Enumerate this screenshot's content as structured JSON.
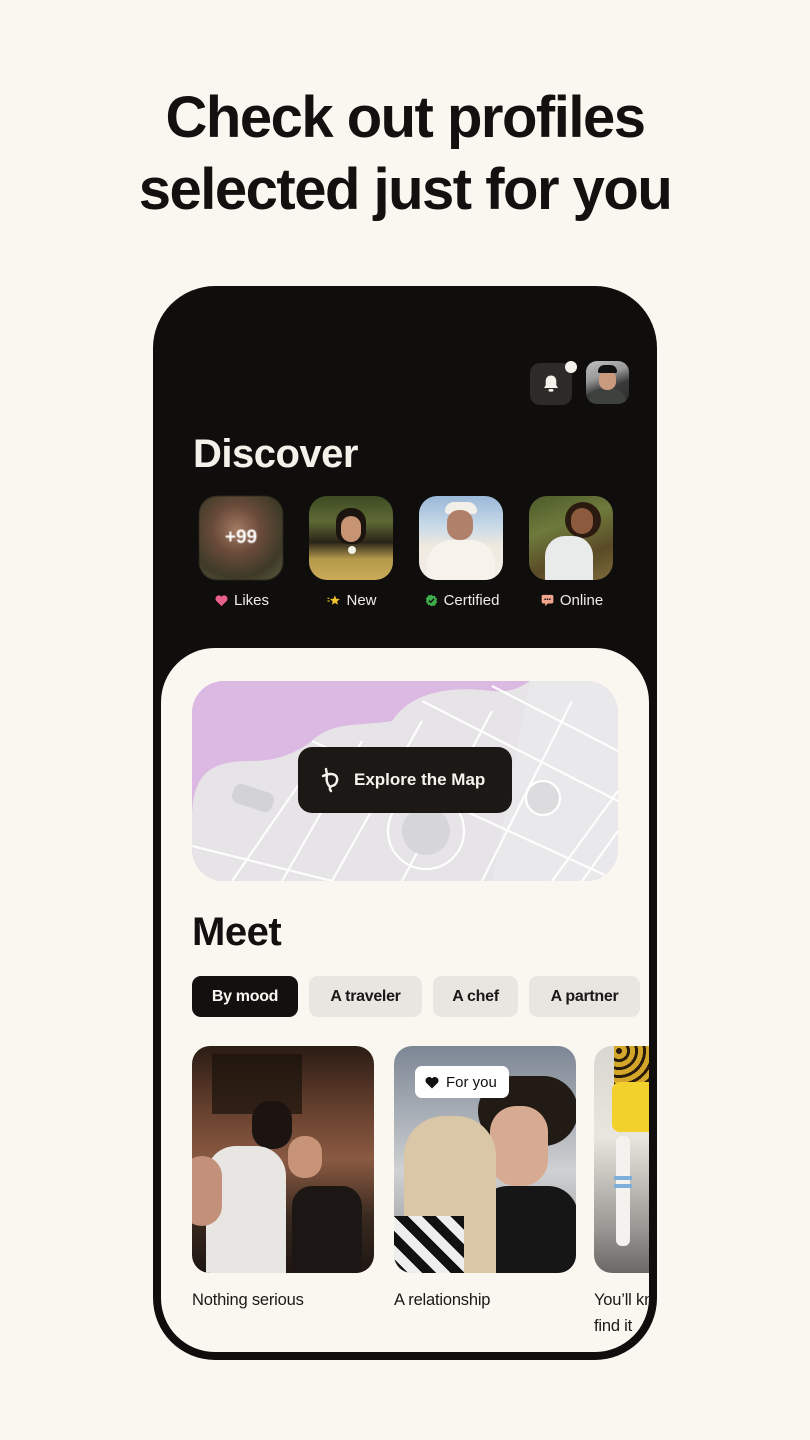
{
  "headline": {
    "line1": "Check out profiles",
    "line2": "selected just for you"
  },
  "topbar": {
    "notifications_icon": "bell-icon",
    "has_unread_notification": true,
    "profile_avatar": "user-avatar"
  },
  "discover": {
    "title": "Discover",
    "stories": [
      {
        "label": "Likes",
        "icon": "heart-icon",
        "icon_color": "#e8618c",
        "overlay_count": "+99",
        "blurred": true
      },
      {
        "label": "New",
        "icon": "sparkle-star-icon",
        "icon_color": "#f2c230"
      },
      {
        "label": "Certified",
        "icon": "verified-check-icon",
        "icon_color": "#3fae4a"
      },
      {
        "label": "Online",
        "icon": "chat-bubble-icon",
        "icon_color": "#f2a58c"
      }
    ]
  },
  "map": {
    "button_label": "Explore the Map",
    "button_icon": "map-logo-icon",
    "accent_color": "#dcb9e2"
  },
  "meet": {
    "title": "Meet",
    "filters": [
      {
        "label": "By mood",
        "active": true
      },
      {
        "label": "A traveler",
        "active": false
      },
      {
        "label": "A chef",
        "active": false
      },
      {
        "label": "A partner",
        "active": false
      }
    ],
    "cards": [
      {
        "caption": "Nothing serious"
      },
      {
        "caption": "A relationship",
        "badge": "For you",
        "badge_icon": "heart-icon"
      },
      {
        "caption": "You’ll know when you find it"
      }
    ]
  },
  "colors": {
    "background": "#faf7f0",
    "phone_dark": "#0f0e0c",
    "chip_inactive": "#e8e6e0"
  }
}
